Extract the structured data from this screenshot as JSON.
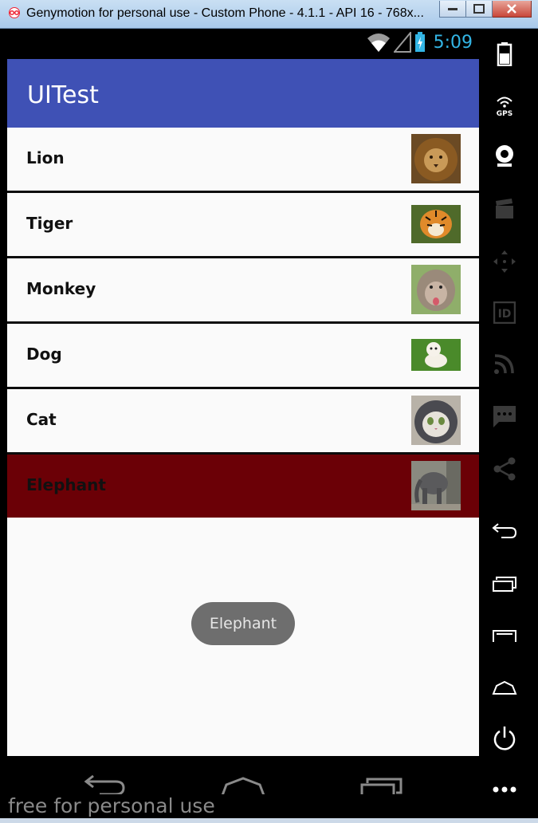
{
  "window": {
    "title": "Genymotion for personal use - Custom Phone - 4.1.1 - API 16 - 768x..."
  },
  "status_bar": {
    "time": "5:09"
  },
  "app": {
    "title": "UITest",
    "accent_color": "#3f51b5",
    "selected_color": "#6b0006"
  },
  "list": {
    "items": [
      {
        "label": "Lion",
        "thumb": "lion-photo"
      },
      {
        "label": "Tiger",
        "thumb": "tiger-photo"
      },
      {
        "label": "Monkey",
        "thumb": "monkey-photo"
      },
      {
        "label": "Dog",
        "thumb": "dog-photo"
      },
      {
        "label": "Cat",
        "thumb": "cat-photo"
      },
      {
        "label": "Elephant",
        "thumb": "elephant-photo"
      }
    ],
    "selected_index": 5
  },
  "toast": {
    "text": "Elephant"
  },
  "watermark": {
    "text": "free for personal use"
  }
}
